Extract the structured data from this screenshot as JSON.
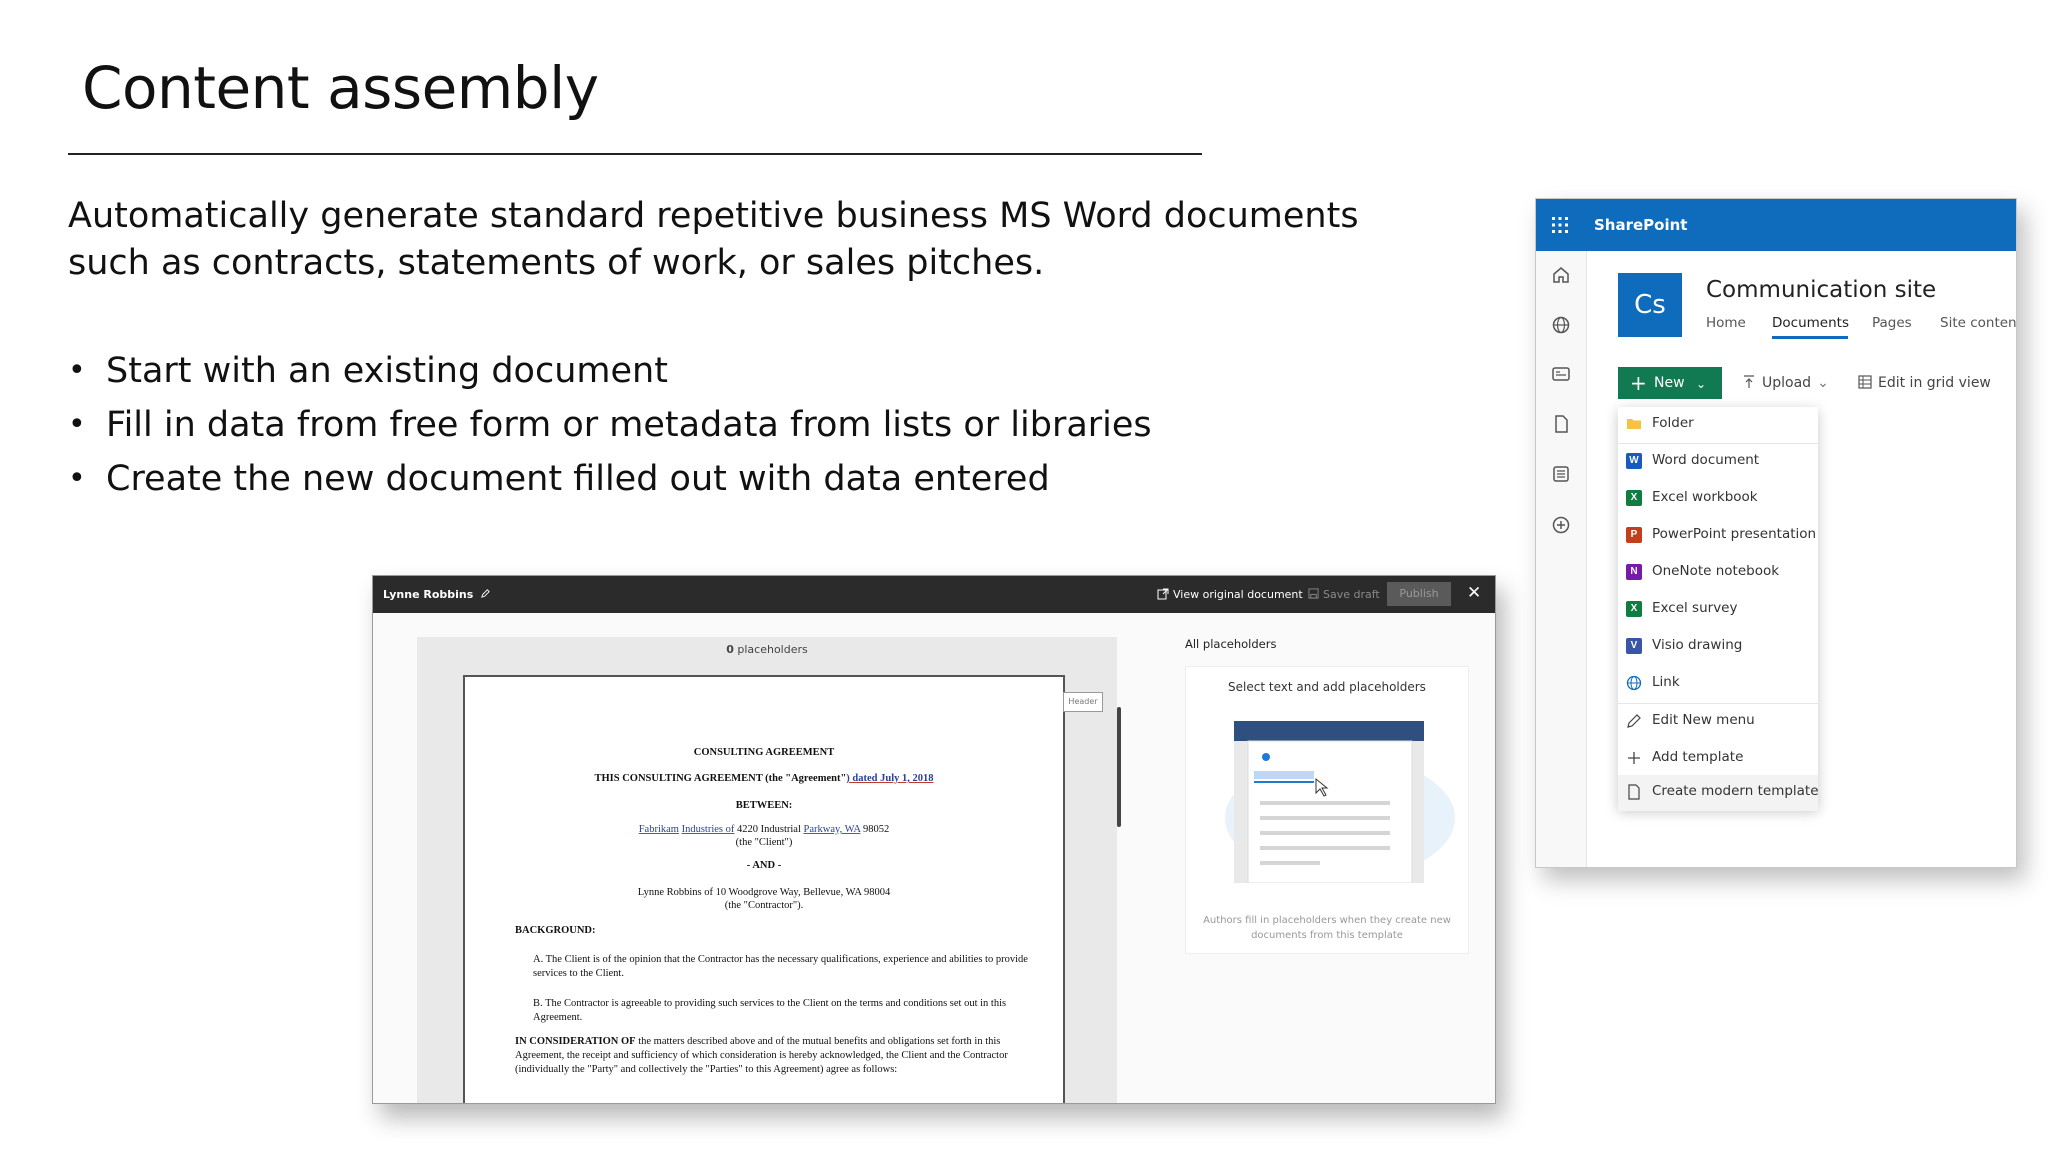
{
  "slide": {
    "title": "Content assembly",
    "intro_line1": "Automatically generate standard repetitive business MS Word documents",
    "intro_line2": "such as contracts, statements of work, or sales pitches.",
    "bullets": [
      "Start with an existing document",
      "Fill in data from free form or metadata from lists or libraries",
      "Create the new document filled out with data entered"
    ]
  },
  "editor": {
    "user": "Lynne Robbins",
    "view_original": "View original document",
    "save_draft": "Save draft",
    "publish": "Publish",
    "placeholders_count": "0",
    "placeholders_label": "placeholders",
    "header_tag": "Header",
    "document": {
      "title": "CONSULTING AGREEMENT",
      "line1_a": "THIS CONSULTING AGREEMENT (the \"Agreement\"",
      "line1_b": ") dated July 1, 2018",
      "between": "BETWEEN:",
      "client_a": "Fabrikam",
      "client_b": "Industries of",
      "client_c": " 4220 Industrial ",
      "client_d": "Parkway,  WA",
      "client_e": " 98052",
      "client_label": "(the \"Client\")",
      "and": "- AND -",
      "contractor": "Lynne Robbins of 10 Woodgrove Way, Bellevue, WA 98004",
      "contractor_label": "(the \"Contractor\").",
      "background": "BACKGROUND:",
      "para_a": "A.  The Client is of the opinion that the Contractor has the necessary qualifications, experience and abilities to provide services to the Client.",
      "para_b": "B.  The Contractor is agreeable to providing such services to the Client on the terms and conditions set out in this Agreement.",
      "consideration_bold": "IN CONSIDERATION OF",
      "consideration_text": " the matters described above and of the mutual benefits and obligations set forth in this Agreement, the receipt and sufficiency of which consideration is hereby acknowledged, the Client and the Contractor (individually the \"Party\" and collectively the \"Parties\" to this Agreement) agree as follows:"
    },
    "panel": {
      "heading": "All placeholders",
      "instruction": "Select text and add placeholders",
      "hint": "Authors fill in placeholders when they create new documents from this template"
    }
  },
  "sharepoint": {
    "brand": "SharePoint",
    "logo_initials": "Cs",
    "site_title": "Communication site",
    "nav": [
      "Home",
      "Documents",
      "Pages",
      "Site contents"
    ],
    "new_label": "New",
    "upload_label": "Upload",
    "grid_label": "Edit in grid view",
    "menu": [
      "Folder",
      "Word document",
      "Excel workbook",
      "PowerPoint presentation",
      "OneNote notebook",
      "Excel survey",
      "Visio drawing",
      "Link",
      "Edit New menu",
      "Add template",
      "Create modern template"
    ],
    "colors": {
      "brand_blue": "#0f6cbd",
      "new_button_green": "#117a52",
      "word": "#185abd",
      "excel": "#107c41",
      "powerpoint": "#c43e1c",
      "onenote": "#7719aa",
      "visio": "#3955a3",
      "folder": "#f5c242"
    }
  }
}
